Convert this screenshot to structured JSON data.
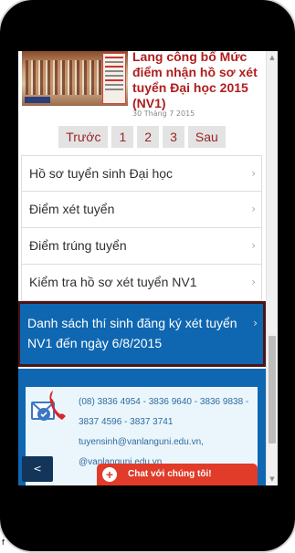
{
  "news": {
    "title": "Lang công bố Mức điểm nhận hồ sơ xét tuyển Đại học 2015 (NV1)",
    "date": "30 Tháng 7 2015"
  },
  "pager": {
    "prev": "Trước",
    "pages": [
      "1",
      "2",
      "3"
    ],
    "next": "Sau"
  },
  "menu": {
    "items": [
      {
        "label": "Hồ sơ tuyển sinh Đại học"
      },
      {
        "label": "Điểm xét tuyển"
      },
      {
        "label": "Điểm trúng tuyển"
      },
      {
        "label": "Kiểm tra hồ sơ xét tuyển NV1"
      },
      {
        "label": "Danh sách thí sinh đăng ký xét tuyển NV1 đến ngày 6/8/2015"
      }
    ],
    "chevron": "›"
  },
  "contact": {
    "phones": "(08) 3836 4954 - 3836 9640 - 3836 9838 - 3837 4596 - 3837 3741",
    "email1": "tuyensinh@vanlanguni.edu.vn,",
    "email2": "@vanlanguni.edu.vn"
  },
  "back_label": "<",
  "chat": {
    "label": "Chat với chúng tôi!",
    "icon": "plus-icon"
  },
  "corner_mark": "f",
  "colors": {
    "accent": "#0f67b1",
    "title_red": "#b01e1e",
    "chat_red": "#e13b2a",
    "active_border": "#4a1414"
  }
}
